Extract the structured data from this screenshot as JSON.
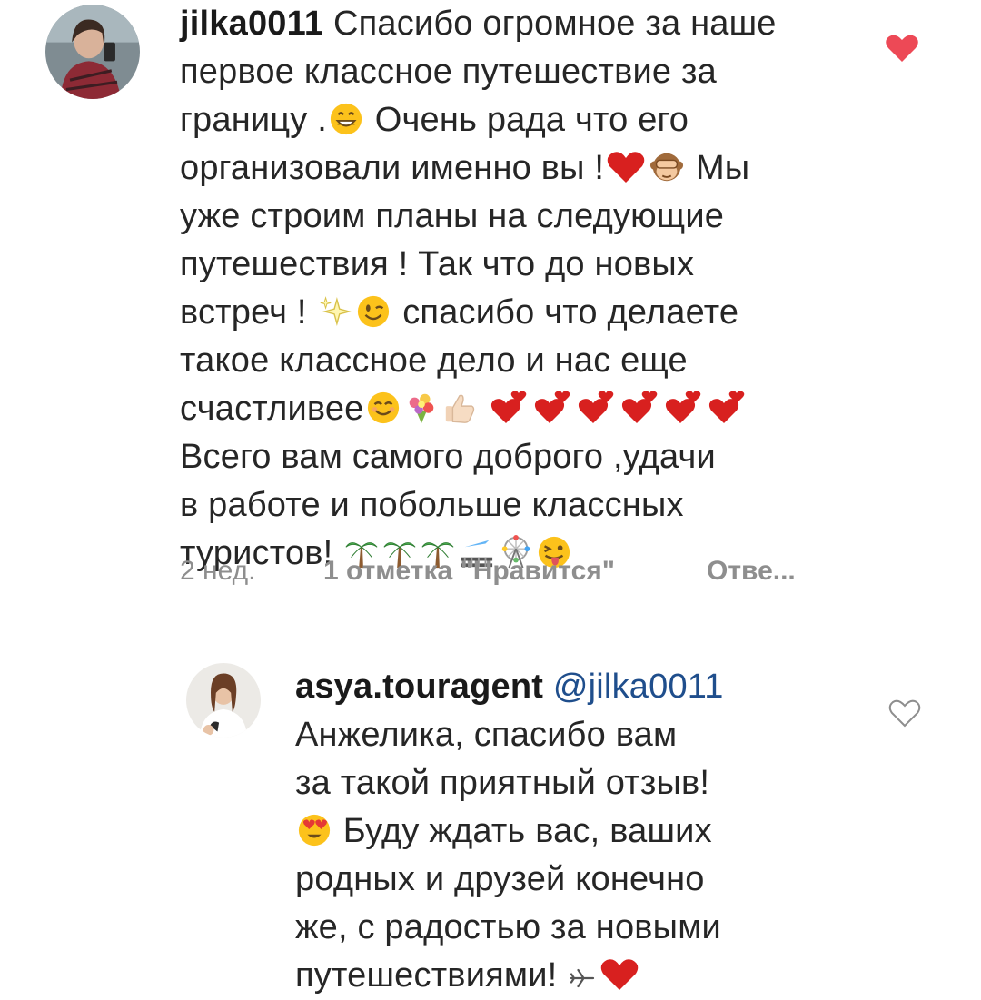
{
  "comment": {
    "username": "jilka0011",
    "lines": [
      "Спасибо огромное за наше",
      "первое классное путешествие за",
      "границу .",
      "Очень рада что его",
      "организовали именно вы !",
      "Мы",
      "уже строим планы на следующие",
      "путешествия ! Так что до новых",
      "встреч !",
      "спасибо что делаете",
      "такое классное дело и нас  еще",
      "счастливее",
      "Всего вам самого доброго ,удачи",
      "в работе  и побольше классных",
      "туристов!"
    ],
    "time": "2 нед.",
    "likes": "1 отметка \"Нравится\"",
    "reply": "Отве..."
  },
  "reply_comment": {
    "username": "asya.touragent",
    "mention": "@jilka0011",
    "lines": [
      "Анжелика, спасибо вам",
      "за такой приятный отзыв!",
      "Буду ждать вас, ваших",
      "родных и друзей конечно",
      "же, с радостью за новыми",
      "путешествиями!"
    ]
  },
  "icons": {
    "like_filled": "heart-filled-icon",
    "like_outline": "heart-outline-icon",
    "emoji": [
      "grin-emoji",
      "red-heart-emoji",
      "see-no-evil-monkey-emoji",
      "sparkles-emoji",
      "wink-emoji",
      "smile-emoji",
      "bouquet-emoji",
      "thumbs-up-emoji",
      "two-hearts-emoji",
      "palm-tree-emoji",
      "railway-emoji",
      "ferris-wheel-emoji",
      "tongue-wink-emoji",
      "airplane-emoji",
      "heart-eyes-emoji"
    ]
  },
  "colors": {
    "heart": "#ed4956",
    "text": "#262626",
    "meta": "#8e8e8e",
    "mention": "#1f4e8c"
  }
}
